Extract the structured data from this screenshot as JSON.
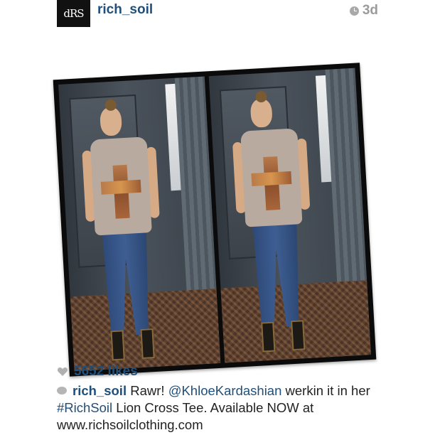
{
  "header": {
    "avatar_text": "dRS",
    "username": "rich_soil",
    "time": "3d",
    "time_icon": "clock-icon"
  },
  "photo": {
    "description_icon": "photo"
  },
  "footer": {
    "likes_icon": "heart-icon",
    "likes": "5652 likes",
    "comment_icon": "comment-icon",
    "caption_user": "rich_soil",
    "caption_part1": " Rawr! ",
    "caption_mention": "@KhloeKardashian",
    "caption_part2": " werkin it in her ",
    "caption_hashtag": "#RichSoil",
    "caption_part3": " Lion Cross Tee. Available NOW at www.richsoilclothing.com"
  },
  "colors": {
    "link": "#1f4f7a",
    "muted": "#9b9b9b",
    "text": "#222222"
  }
}
